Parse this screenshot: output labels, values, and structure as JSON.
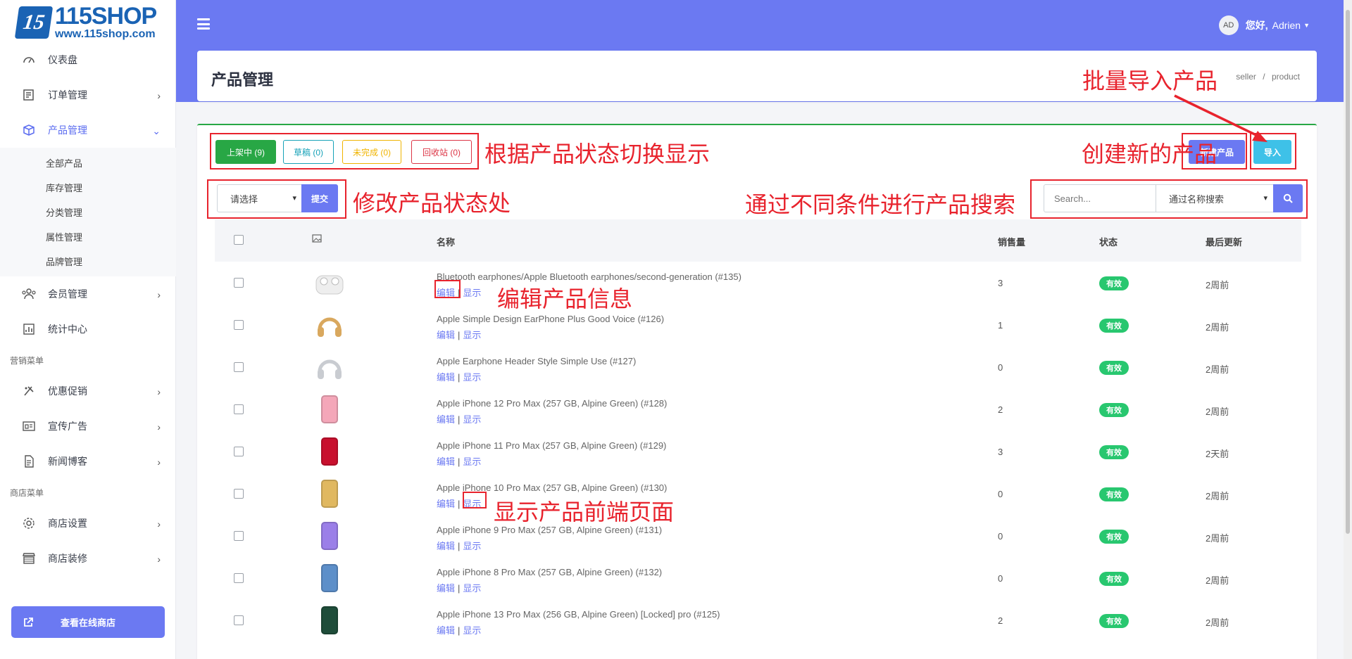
{
  "brand": {
    "name": "115SHOP",
    "url": "www.115shop.com",
    "mark": "15"
  },
  "sidebar": {
    "items": [
      {
        "label": "仪表盘",
        "icon": "dashboard-icon"
      },
      {
        "label": "订单管理",
        "icon": "orders-icon"
      },
      {
        "label": "产品管理",
        "icon": "products-icon"
      },
      {
        "label": "会员管理",
        "icon": "members-icon"
      },
      {
        "label": "统计中心",
        "icon": "stats-icon"
      }
    ],
    "product_sub": [
      "全部产品",
      "库存管理",
      "分类管理",
      "属性管理",
      "品牌管理"
    ],
    "section_marketing": "营销菜单",
    "marketing": [
      {
        "label": "优惠促销",
        "icon": "promotion-icon"
      },
      {
        "label": "宣传广告",
        "icon": "ads-icon"
      },
      {
        "label": "新闻博客",
        "icon": "blog-icon"
      }
    ],
    "section_shop": "商店菜单",
    "shop": [
      {
        "label": "商店设置",
        "icon": "settings-icon"
      },
      {
        "label": "商店装修",
        "icon": "decor-icon"
      }
    ],
    "view_shop": "查看在线商店"
  },
  "header": {
    "avatar": "AD",
    "greeting": "您好,",
    "user": "Adrien"
  },
  "page": {
    "title": "产品管理",
    "breadcrumb_1": "seller",
    "breadcrumb_sep": "/",
    "breadcrumb_2": "product"
  },
  "tabs": {
    "active": "上架中 (9)",
    "draft": "草稿 (0)",
    "incomplete": "未完成 (0)",
    "trash": "回收站 (0)"
  },
  "actions": {
    "new_product": "新建产品",
    "import": "导入"
  },
  "bulk": {
    "select": "请选择",
    "submit": "提交"
  },
  "search": {
    "placeholder": "Search...",
    "mode": "通过名称搜索"
  },
  "table": {
    "headers": {
      "name": "名称",
      "sales": "销售量",
      "status": "状态",
      "updated": "最后更新"
    },
    "edit": "编辑",
    "sep": "|",
    "show": "显示",
    "rows": [
      {
        "name": "Bluetooth earphones/Apple Bluetooth earphones/second-generation (#135)",
        "sales": "3",
        "status": "有效",
        "updated": "2周前",
        "thumb": "airpods",
        "color": "#eeeeee"
      },
      {
        "name": "Apple Simple Design EarPhone Plus Good Voice (#126)",
        "sales": "1",
        "status": "有效",
        "updated": "2周前",
        "thumb": "headphone",
        "color": "#d9a85e"
      },
      {
        "name": "Apple Earphone Header Style Simple Use (#127)",
        "sales": "0",
        "status": "有效",
        "updated": "2周前",
        "thumb": "headphone",
        "color": "#c9ccd1"
      },
      {
        "name": "Apple iPhone 12 Pro Max (257 GB, Alpine Green) (#128)",
        "sales": "2",
        "status": "有效",
        "updated": "2周前",
        "thumb": "phone",
        "color": "#f4a7b9"
      },
      {
        "name": "Apple iPhone 11 Pro Max (257 GB, Alpine Green) (#129)",
        "sales": "3",
        "status": "有效",
        "updated": "2天前",
        "thumb": "phone",
        "color": "#c8102e"
      },
      {
        "name": "Apple iPhone 10 Pro Max (257 GB, Alpine Green) (#130)",
        "sales": "0",
        "status": "有效",
        "updated": "2周前",
        "thumb": "phone",
        "color": "#e0b860"
      },
      {
        "name": "Apple iPhone 9 Pro Max (257 GB, Alpine Green) (#131)",
        "sales": "0",
        "status": "有效",
        "updated": "2周前",
        "thumb": "phone",
        "color": "#9b7fe8"
      },
      {
        "name": "Apple iPhone 8 Pro Max (257 GB, Alpine Green) (#132)",
        "sales": "0",
        "status": "有效",
        "updated": "2周前",
        "thumb": "phone",
        "color": "#5d8fc9"
      },
      {
        "name": "Apple iPhone 13 Pro Max (256 GB, Alpine Green) [Locked] pro (#125)",
        "sales": "2",
        "status": "有效",
        "updated": "2周前",
        "thumb": "phone",
        "color": "#1f4d3a"
      }
    ]
  },
  "annotations": {
    "import": "批量导入产品",
    "tabs": "根据产品状态切换显示",
    "new": "创建新的产品",
    "bulk": "修改产品状态处",
    "search": "通过不同条件进行产品搜索",
    "edit": "编辑产品信息",
    "show": "显示产品前端页面"
  },
  "colors": {
    "accent": "#6b79f2",
    "success": "#28a745",
    "badge": "#28c76f",
    "annotation": "#e8232d"
  }
}
